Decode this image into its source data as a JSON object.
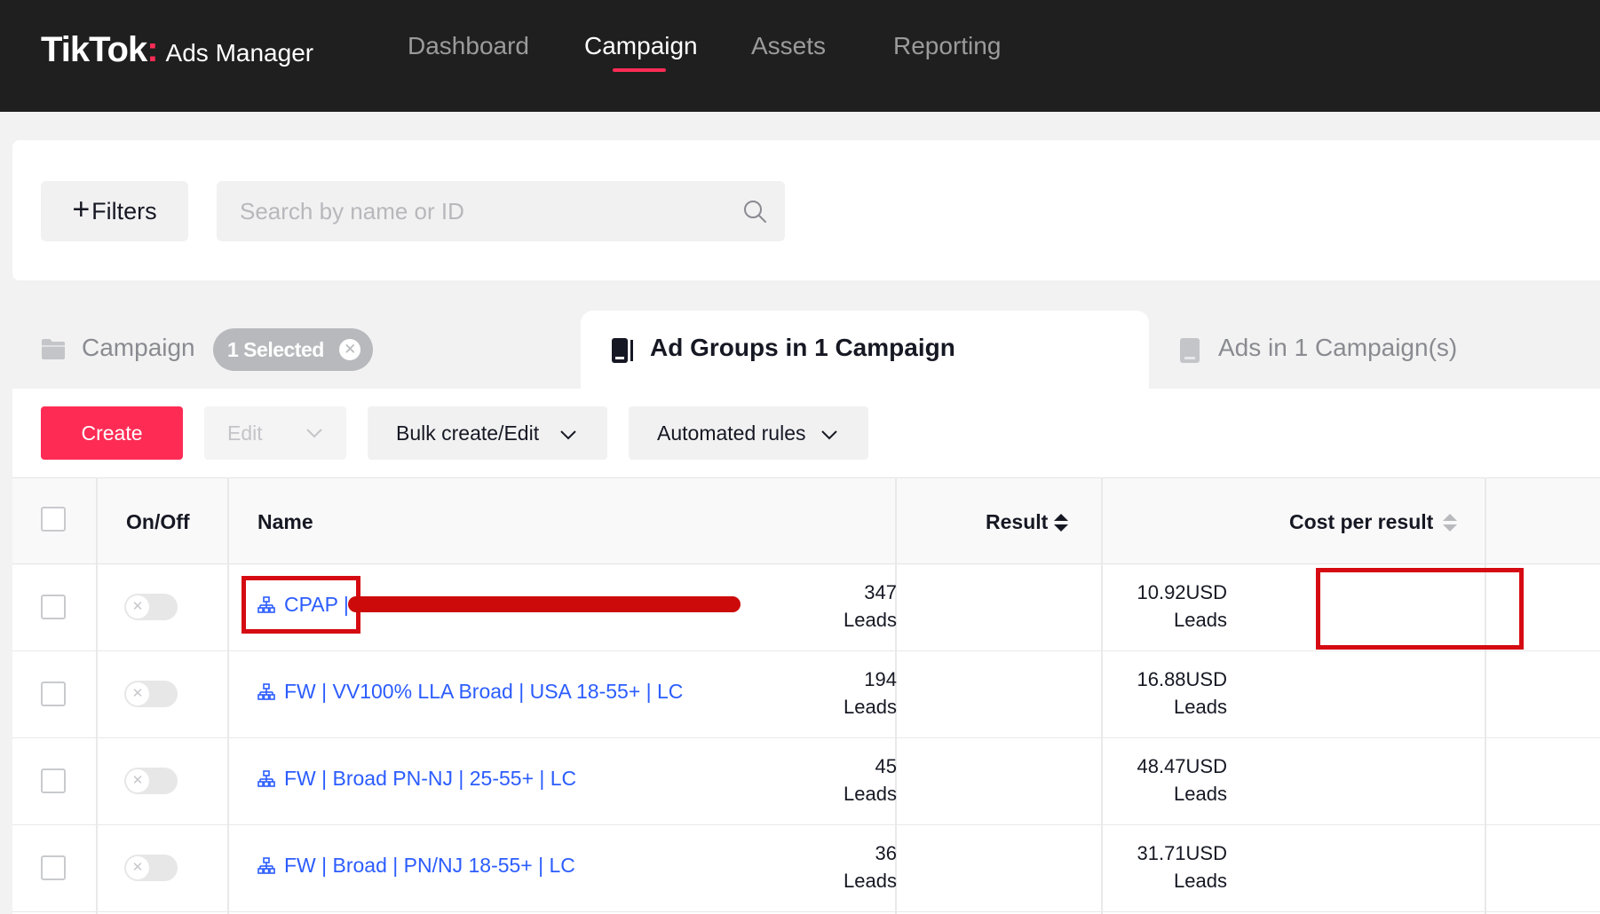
{
  "brand": {
    "name": "TikTok",
    "colon": ":",
    "sub": "Ads Manager"
  },
  "nav": {
    "items": [
      "Dashboard",
      "Campaign",
      "Assets",
      "Reporting"
    ],
    "active": "Campaign"
  },
  "filters": {
    "button_label": "Filters",
    "search_placeholder": "Search by name or ID"
  },
  "tabs": {
    "campaign": {
      "label": "Campaign",
      "selected_chip": "1 Selected"
    },
    "ad_groups": {
      "label": "Ad Groups in 1 Campaign"
    },
    "ads": {
      "label": "Ads in 1 Campaign(s)"
    }
  },
  "toolbar": {
    "create": "Create",
    "edit": "Edit",
    "bulk": "Bulk create/Edit",
    "rules": "Automated rules"
  },
  "table": {
    "columns": {
      "onoff": "On/Off",
      "name": "Name",
      "result": "Result",
      "cost": "Cost per result"
    },
    "rows": [
      {
        "name": "CPAP |",
        "result_value": "347",
        "result_unit": "Leads",
        "cost_value": "10.92USD",
        "cost_unit": "Leads"
      },
      {
        "name": "FW | VV100% LLA Broad | USA 18-55+ | LC",
        "result_value": "194",
        "result_unit": "Leads",
        "cost_value": "16.88USD",
        "cost_unit": "Leads"
      },
      {
        "name": "FW | Broad PN-NJ | 25-55+ | LC",
        "result_value": "45",
        "result_unit": "Leads",
        "cost_value": "48.47USD",
        "cost_unit": "Leads"
      },
      {
        "name": "FW | Broad | PN/NJ 18-55+ | LC",
        "result_value": "36",
        "result_unit": "Leads",
        "cost_value": "31.71USD",
        "cost_unit": "Leads"
      }
    ]
  },
  "colors": {
    "accent": "#fe2c55",
    "link": "#2b5cff",
    "annotation": "#d50a12",
    "topbar": "#1f1f1f"
  }
}
